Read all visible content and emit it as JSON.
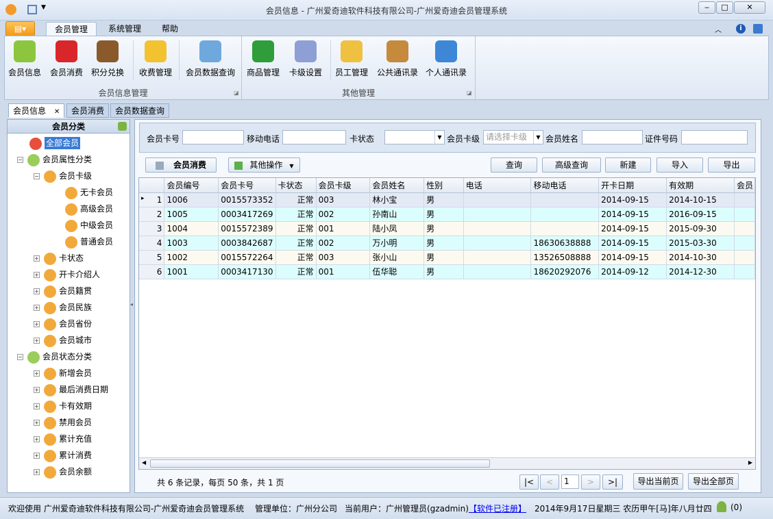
{
  "window": {
    "title": "会员信息 - 广州爱奇迪软件科技有限公司-广州爱奇迪会员管理系统",
    "minimize": "‒",
    "maximize": "□",
    "close": "✕"
  },
  "ribbon_tabs": [
    {
      "label": "会员管理"
    },
    {
      "label": "系统管理"
    },
    {
      "label": "帮助"
    }
  ],
  "ribbon": {
    "groups": [
      {
        "label": "会员信息管理"
      },
      {
        "label": "其他管理"
      }
    ],
    "buttons": [
      {
        "label": "会员信息",
        "icon": "members-icon",
        "color": "#8cc63f"
      },
      {
        "label": "会员消费",
        "icon": "basket-icon",
        "color": "#d9262b"
      },
      {
        "label": "积分兑换",
        "icon": "teddy-bear-icon",
        "color": "#8b5a2b"
      },
      {
        "label": "收费管理",
        "icon": "coins-add-icon",
        "color": "#f2c231"
      },
      {
        "label": "会员数据查询",
        "icon": "document-search-icon",
        "color": "#6fa8dc"
      },
      {
        "label": "商品管理",
        "icon": "shapes-icon",
        "color": "#2f9e3a"
      },
      {
        "label": "卡级设置",
        "icon": "id-card-icon",
        "color": "#8e9fd6"
      },
      {
        "label": "员工管理",
        "icon": "employee-icon",
        "color": "#f0c040"
      },
      {
        "label": "公共通讯录",
        "icon": "address-book-icon",
        "color": "#c68a3c"
      },
      {
        "label": "个人通讯录",
        "icon": "personal-book-icon",
        "color": "#3d87d6"
      }
    ]
  },
  "doc_tabs": [
    {
      "label": "会员信息",
      "close": "✕"
    },
    {
      "label": "会员消费"
    },
    {
      "label": "会员数据查询"
    }
  ],
  "tree": {
    "title": "会员分类",
    "nodes": [
      {
        "label": "全部会员",
        "level": 0,
        "selected": true
      },
      {
        "label": "会员属性分类",
        "level": 0,
        "exp": "−"
      },
      {
        "label": "会员卡级",
        "level": 1,
        "exp": "−"
      },
      {
        "label": "无卡会员",
        "level": 2
      },
      {
        "label": "高级会员",
        "level": 2
      },
      {
        "label": "中级会员",
        "level": 2
      },
      {
        "label": "普通会员",
        "level": 2
      },
      {
        "label": "卡状态",
        "level": 1,
        "exp": "+"
      },
      {
        "label": "开卡介绍人",
        "level": 1,
        "exp": "+"
      },
      {
        "label": "会员籍贯",
        "level": 1,
        "exp": "+"
      },
      {
        "label": "会员民族",
        "level": 1,
        "exp": "+"
      },
      {
        "label": "会员省份",
        "level": 1,
        "exp": "+"
      },
      {
        "label": "会员城市",
        "level": 1,
        "exp": "+"
      },
      {
        "label": "会员状态分类",
        "level": 0,
        "exp": "−"
      },
      {
        "label": "新增会员",
        "level": 1,
        "exp": "+"
      },
      {
        "label": "最后消费日期",
        "level": 1,
        "exp": "+"
      },
      {
        "label": "卡有效期",
        "level": 1,
        "exp": "+"
      },
      {
        "label": "禁用会员",
        "level": 1,
        "exp": "+"
      },
      {
        "label": "累计充值",
        "level": 1,
        "exp": "+"
      },
      {
        "label": "累计消费",
        "level": 1,
        "exp": "+"
      },
      {
        "label": "会员余额",
        "level": 1,
        "exp": "+"
      }
    ]
  },
  "filter": {
    "card_no": "会员卡号",
    "mobile": "移动电话",
    "status": "卡状态",
    "level": "会员卡级",
    "level_placeholder": "请选择卡级",
    "name": "会员姓名",
    "id_no": "证件号码"
  },
  "toolbar": {
    "consume": "会员消费",
    "other": "其他操作",
    "query": "查询",
    "adv_query": "高级查询",
    "new": "新建",
    "import": "导入",
    "export": "导出"
  },
  "grid": {
    "columns": [
      "",
      "会员编号",
      "会员卡号",
      "卡状态",
      "会员卡级",
      "会员姓名",
      "性别",
      "电话",
      "移动电话",
      "开卡日期",
      "有效期",
      "会员"
    ],
    "rows": [
      [
        "1",
        "1006",
        "0015573352",
        "正常",
        "003",
        "林小宝",
        "男",
        "",
        "",
        "2014-09-15",
        "2014-10-15",
        ""
      ],
      [
        "2",
        "1005",
        "0003417269",
        "正常",
        "002",
        "孙南山",
        "男",
        "",
        "",
        "2014-09-15",
        "2016-09-15",
        ""
      ],
      [
        "3",
        "1004",
        "0015572389",
        "正常",
        "001",
        "陆小凤",
        "男",
        "",
        "",
        "2014-09-15",
        "2015-09-30",
        ""
      ],
      [
        "4",
        "1003",
        "0003842687",
        "正常",
        "002",
        "万小明",
        "男",
        "",
        "18630638888",
        "2014-09-15",
        "2015-03-30",
        ""
      ],
      [
        "5",
        "1002",
        "0015572264",
        "正常",
        "003",
        "张小山",
        "男",
        "",
        "13526508888",
        "2014-09-15",
        "2014-10-30",
        ""
      ],
      [
        "6",
        "1001",
        "0003417130",
        "正常",
        "001",
        "伍华聪",
        "男",
        "",
        "18620292076",
        "2014-09-12",
        "2014-12-30",
        ""
      ]
    ]
  },
  "pager": {
    "summary": "共 6 条记录，每页 50 条，共 1 页",
    "first": "|<",
    "prev": "<",
    "page": "1",
    "next": ">",
    "last": ">|",
    "export_page": "导出当前页",
    "export_all": "导出全部页"
  },
  "status": {
    "welcome": "欢迎使用 广州爱奇迪软件科技有限公司-广州爱奇迪会员管理系统",
    "unit": "管理单位：广州分公司",
    "user": "当前用户：广州管理员(gzadmin)",
    "registered": "【软件已注册】",
    "date": "2014年9月17日星期三 农历甲午[马]年八月廿四",
    "online": "(0)"
  }
}
